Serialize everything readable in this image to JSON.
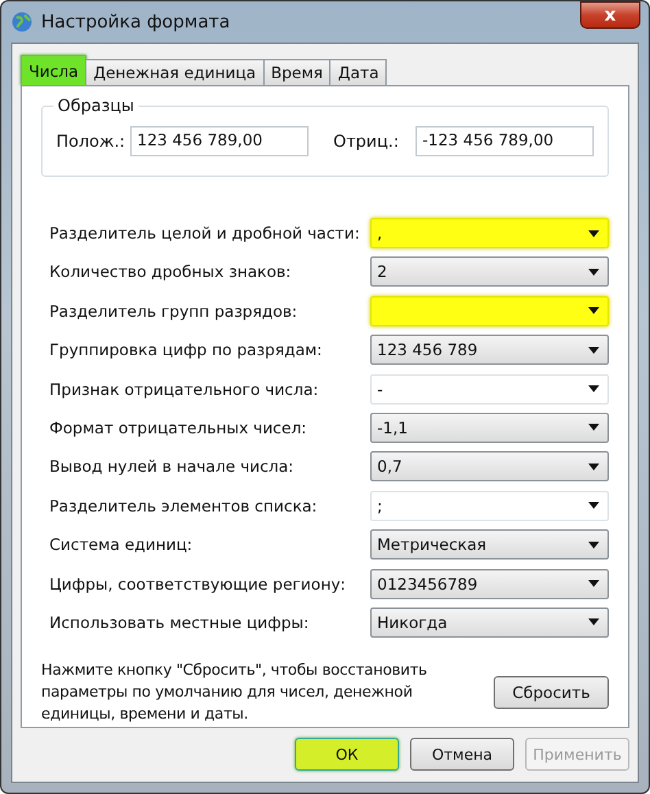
{
  "window": {
    "title": "Настройка формата",
    "close": "x"
  },
  "tabs": [
    {
      "label": "Числа",
      "selected": true,
      "highlighted": true
    },
    {
      "label": "Денежная единица",
      "selected": false,
      "highlighted": false
    },
    {
      "label": "Время",
      "selected": false,
      "highlighted": false
    },
    {
      "label": "Дата",
      "selected": false,
      "highlighted": false
    }
  ],
  "samples": {
    "title": "Образцы",
    "positive_label": "Полож.:",
    "positive": "123 456 789,00",
    "negative_label": "Отриц.:",
    "negative": "-123 456 789,00"
  },
  "settings": [
    {
      "label": "Разделитель целой и дробной части:",
      "value": ",",
      "kind": "editable",
      "highlighted": true
    },
    {
      "label": "Количество дробных знаков:",
      "value": "2",
      "kind": "list",
      "highlighted": false
    },
    {
      "label": "Разделитель групп разрядов:",
      "kind": "editable",
      "highlighted": true
    },
    {
      "label": "Группировка цифр по разрядам:",
      "value": "123 456 789",
      "kind": "list",
      "highlighted": false
    },
    {
      "label": "Признак отрицательного числа:",
      "value": "-",
      "kind": "editable",
      "highlighted": false
    },
    {
      "label": "Формат отрицательных чисел:",
      "value": "-1,1",
      "kind": "list",
      "highlighted": false
    },
    {
      "label": "Вывод нулей в начале числа:",
      "value": "0,7",
      "kind": "list",
      "highlighted": false
    },
    {
      "label": "Разделитель элементов списка:",
      "value": ";",
      "kind": "editable",
      "highlighted": false
    },
    {
      "label": "Система единиц:",
      "value": "Метрическая",
      "kind": "list",
      "highlighted": false
    },
    {
      "label": "Цифры, соответствующие региону:",
      "value": "0123456789",
      "kind": "list",
      "highlighted": false
    },
    {
      "label": "Использовать местные цифры:",
      "value": "Никогда",
      "kind": "list",
      "highlighted": false
    }
  ],
  "reset": {
    "text": "Нажмите кнопку \"Сбросить\", чтобы восстановить параметры по умолчанию для чисел, денежной единицы, времени и даты.",
    "button": "Сбросить"
  },
  "buttons": [
    {
      "label": "ОК",
      "highlighted": true,
      "disabled": false
    },
    {
      "label": "Отмена",
      "highlighted": false,
      "disabled": false
    },
    {
      "label": "Применить",
      "highlighted": false,
      "disabled": true
    }
  ]
}
